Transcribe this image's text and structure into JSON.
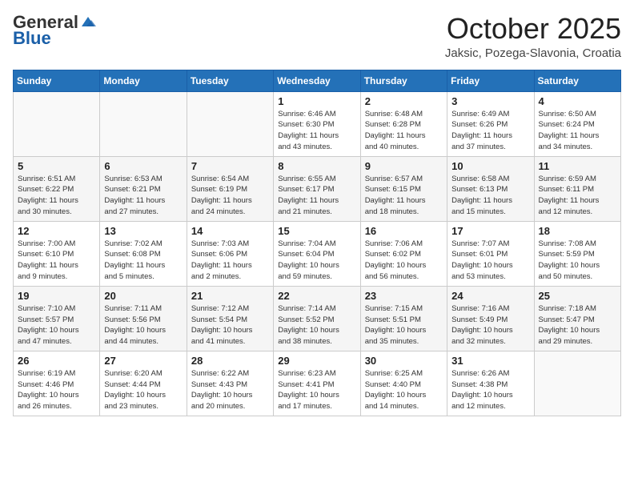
{
  "header": {
    "logo_general": "General",
    "logo_blue": "Blue",
    "month_title": "October 2025",
    "location": "Jaksic, Pozega-Slavonia, Croatia"
  },
  "weekdays": [
    "Sunday",
    "Monday",
    "Tuesday",
    "Wednesday",
    "Thursday",
    "Friday",
    "Saturday"
  ],
  "weeks": [
    [
      {
        "day": "",
        "info": ""
      },
      {
        "day": "",
        "info": ""
      },
      {
        "day": "",
        "info": ""
      },
      {
        "day": "1",
        "info": "Sunrise: 6:46 AM\nSunset: 6:30 PM\nDaylight: 11 hours\nand 43 minutes."
      },
      {
        "day": "2",
        "info": "Sunrise: 6:48 AM\nSunset: 6:28 PM\nDaylight: 11 hours\nand 40 minutes."
      },
      {
        "day": "3",
        "info": "Sunrise: 6:49 AM\nSunset: 6:26 PM\nDaylight: 11 hours\nand 37 minutes."
      },
      {
        "day": "4",
        "info": "Sunrise: 6:50 AM\nSunset: 6:24 PM\nDaylight: 11 hours\nand 34 minutes."
      }
    ],
    [
      {
        "day": "5",
        "info": "Sunrise: 6:51 AM\nSunset: 6:22 PM\nDaylight: 11 hours\nand 30 minutes."
      },
      {
        "day": "6",
        "info": "Sunrise: 6:53 AM\nSunset: 6:21 PM\nDaylight: 11 hours\nand 27 minutes."
      },
      {
        "day": "7",
        "info": "Sunrise: 6:54 AM\nSunset: 6:19 PM\nDaylight: 11 hours\nand 24 minutes."
      },
      {
        "day": "8",
        "info": "Sunrise: 6:55 AM\nSunset: 6:17 PM\nDaylight: 11 hours\nand 21 minutes."
      },
      {
        "day": "9",
        "info": "Sunrise: 6:57 AM\nSunset: 6:15 PM\nDaylight: 11 hours\nand 18 minutes."
      },
      {
        "day": "10",
        "info": "Sunrise: 6:58 AM\nSunset: 6:13 PM\nDaylight: 11 hours\nand 15 minutes."
      },
      {
        "day": "11",
        "info": "Sunrise: 6:59 AM\nSunset: 6:11 PM\nDaylight: 11 hours\nand 12 minutes."
      }
    ],
    [
      {
        "day": "12",
        "info": "Sunrise: 7:00 AM\nSunset: 6:10 PM\nDaylight: 11 hours\nand 9 minutes."
      },
      {
        "day": "13",
        "info": "Sunrise: 7:02 AM\nSunset: 6:08 PM\nDaylight: 11 hours\nand 5 minutes."
      },
      {
        "day": "14",
        "info": "Sunrise: 7:03 AM\nSunset: 6:06 PM\nDaylight: 11 hours\nand 2 minutes."
      },
      {
        "day": "15",
        "info": "Sunrise: 7:04 AM\nSunset: 6:04 PM\nDaylight: 10 hours\nand 59 minutes."
      },
      {
        "day": "16",
        "info": "Sunrise: 7:06 AM\nSunset: 6:02 PM\nDaylight: 10 hours\nand 56 minutes."
      },
      {
        "day": "17",
        "info": "Sunrise: 7:07 AM\nSunset: 6:01 PM\nDaylight: 10 hours\nand 53 minutes."
      },
      {
        "day": "18",
        "info": "Sunrise: 7:08 AM\nSunset: 5:59 PM\nDaylight: 10 hours\nand 50 minutes."
      }
    ],
    [
      {
        "day": "19",
        "info": "Sunrise: 7:10 AM\nSunset: 5:57 PM\nDaylight: 10 hours\nand 47 minutes."
      },
      {
        "day": "20",
        "info": "Sunrise: 7:11 AM\nSunset: 5:56 PM\nDaylight: 10 hours\nand 44 minutes."
      },
      {
        "day": "21",
        "info": "Sunrise: 7:12 AM\nSunset: 5:54 PM\nDaylight: 10 hours\nand 41 minutes."
      },
      {
        "day": "22",
        "info": "Sunrise: 7:14 AM\nSunset: 5:52 PM\nDaylight: 10 hours\nand 38 minutes."
      },
      {
        "day": "23",
        "info": "Sunrise: 7:15 AM\nSunset: 5:51 PM\nDaylight: 10 hours\nand 35 minutes."
      },
      {
        "day": "24",
        "info": "Sunrise: 7:16 AM\nSunset: 5:49 PM\nDaylight: 10 hours\nand 32 minutes."
      },
      {
        "day": "25",
        "info": "Sunrise: 7:18 AM\nSunset: 5:47 PM\nDaylight: 10 hours\nand 29 minutes."
      }
    ],
    [
      {
        "day": "26",
        "info": "Sunrise: 6:19 AM\nSunset: 4:46 PM\nDaylight: 10 hours\nand 26 minutes."
      },
      {
        "day": "27",
        "info": "Sunrise: 6:20 AM\nSunset: 4:44 PM\nDaylight: 10 hours\nand 23 minutes."
      },
      {
        "day": "28",
        "info": "Sunrise: 6:22 AM\nSunset: 4:43 PM\nDaylight: 10 hours\nand 20 minutes."
      },
      {
        "day": "29",
        "info": "Sunrise: 6:23 AM\nSunset: 4:41 PM\nDaylight: 10 hours\nand 17 minutes."
      },
      {
        "day": "30",
        "info": "Sunrise: 6:25 AM\nSunset: 4:40 PM\nDaylight: 10 hours\nand 14 minutes."
      },
      {
        "day": "31",
        "info": "Sunrise: 6:26 AM\nSunset: 4:38 PM\nDaylight: 10 hours\nand 12 minutes."
      },
      {
        "day": "",
        "info": ""
      }
    ]
  ]
}
